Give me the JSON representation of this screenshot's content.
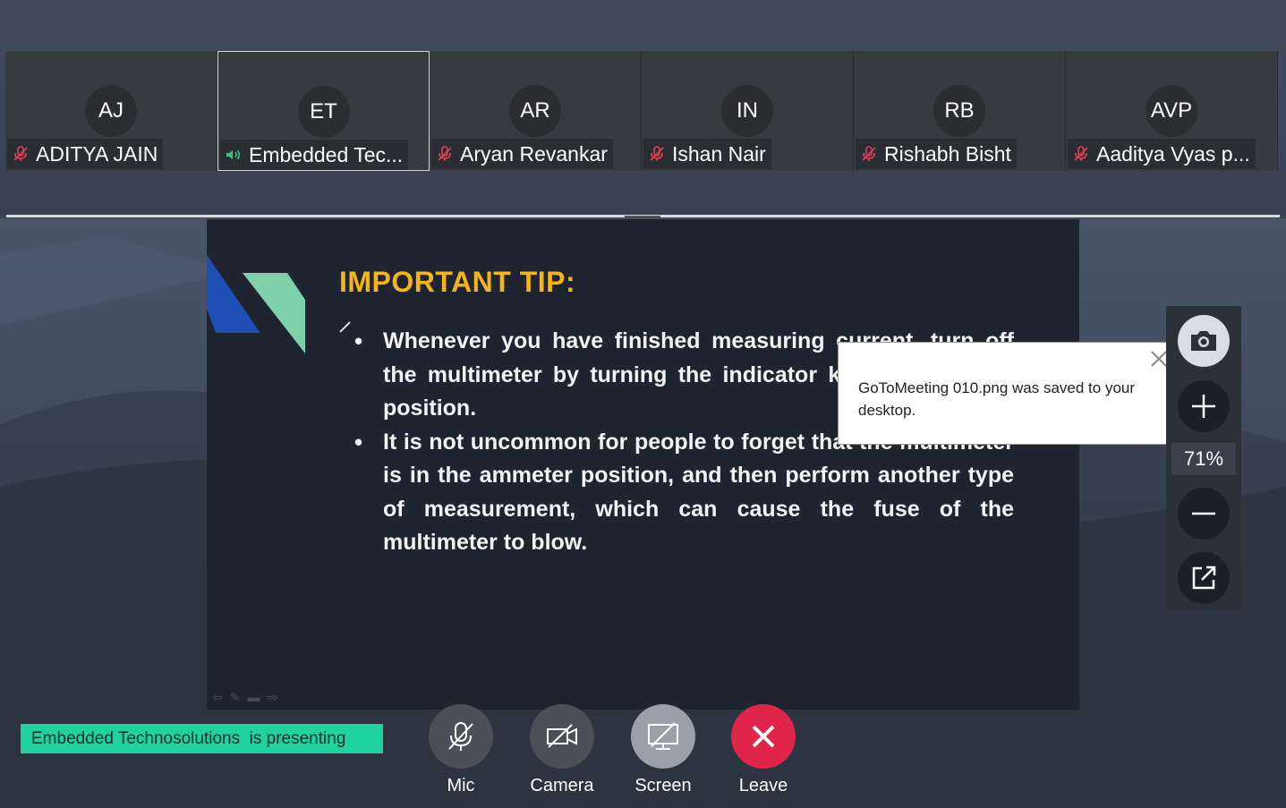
{
  "participants": [
    {
      "initials": "AJ",
      "name": "ADITYA JAIN",
      "audio": "muted-mic-icon"
    },
    {
      "initials": "ET",
      "name": "Embedded Tec...",
      "audio": "speaker-icon"
    },
    {
      "initials": "AR",
      "name": "Aryan Revankar",
      "audio": "muted-mic-icon"
    },
    {
      "initials": "IN",
      "name": "Ishan Nair",
      "audio": "muted-mic-icon"
    },
    {
      "initials": "RB",
      "name": "Rishabh Bisht",
      "audio": "muted-mic-icon"
    },
    {
      "initials": "AVP",
      "name": "Aaditya Vyas p...",
      "audio": "muted-mic-icon"
    }
  ],
  "slide": {
    "title": "IMPORTANT TIP:",
    "bullets": [
      "Whenever you have finished measuring current, turn off the multimeter by turning the indicator knob to the OFF position.",
      "It is not uncommon for people to forget that the multimeter is in the ammeter position, and then perform another type of measurement, which can cause the fuse of the multimeter to blow."
    ]
  },
  "zoom": {
    "level": "71%"
  },
  "toast": {
    "message": "GoToMeeting 010.png was saved to your desktop."
  },
  "presenter_banner": "Embedded Technosolutions  is presenting",
  "controls": {
    "mic": "Mic",
    "camera": "Camera",
    "screen": "Screen",
    "leave": "Leave"
  },
  "colors": {
    "accent_green": "#1ed3a0",
    "leave_red": "#e0244a",
    "slide_title": "#f4b41a",
    "muted_red": "#e0405a",
    "speaking_green": "#2ecc71"
  }
}
